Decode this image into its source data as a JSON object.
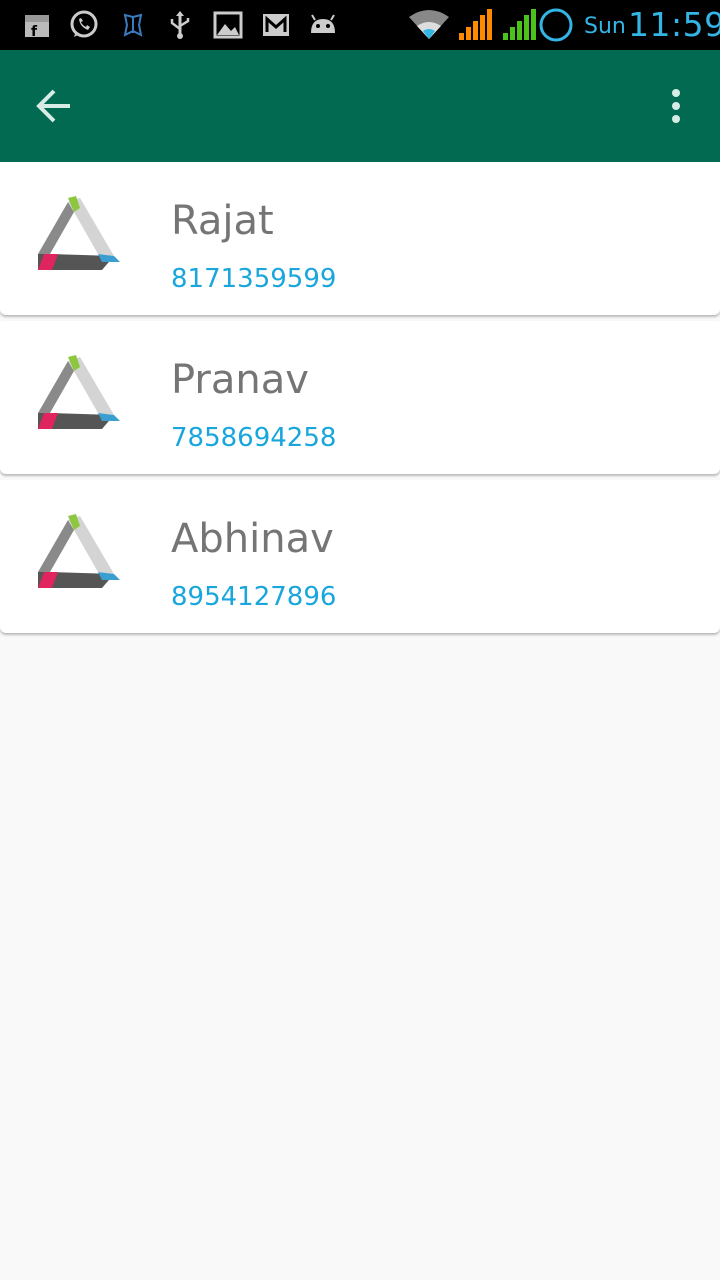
{
  "status_bar": {
    "icons": [
      "shop-icon",
      "whatsapp-icon",
      "butterfly-icon",
      "usb-icon",
      "image-icon",
      "gmail-icon",
      "android-icon",
      "wifi-icon",
      "signal-orange-icon",
      "signal-green-icon",
      "circle-icon"
    ],
    "day": "Sun",
    "time": "11:59",
    "accent_color": "#33b5e5"
  },
  "app_bar": {
    "color": "#016a51",
    "back_icon": "arrow-left-icon",
    "menu_icon": "more-vert-icon"
  },
  "contacts": [
    {
      "name": "Rajat",
      "phone": "8171359599",
      "logo": "triangle-logo-icon"
    },
    {
      "name": "Pranav",
      "phone": "7858694258",
      "logo": "triangle-logo-icon"
    },
    {
      "name": "Abhinav",
      "phone": "8954127896",
      "logo": "triangle-logo-icon"
    }
  ]
}
